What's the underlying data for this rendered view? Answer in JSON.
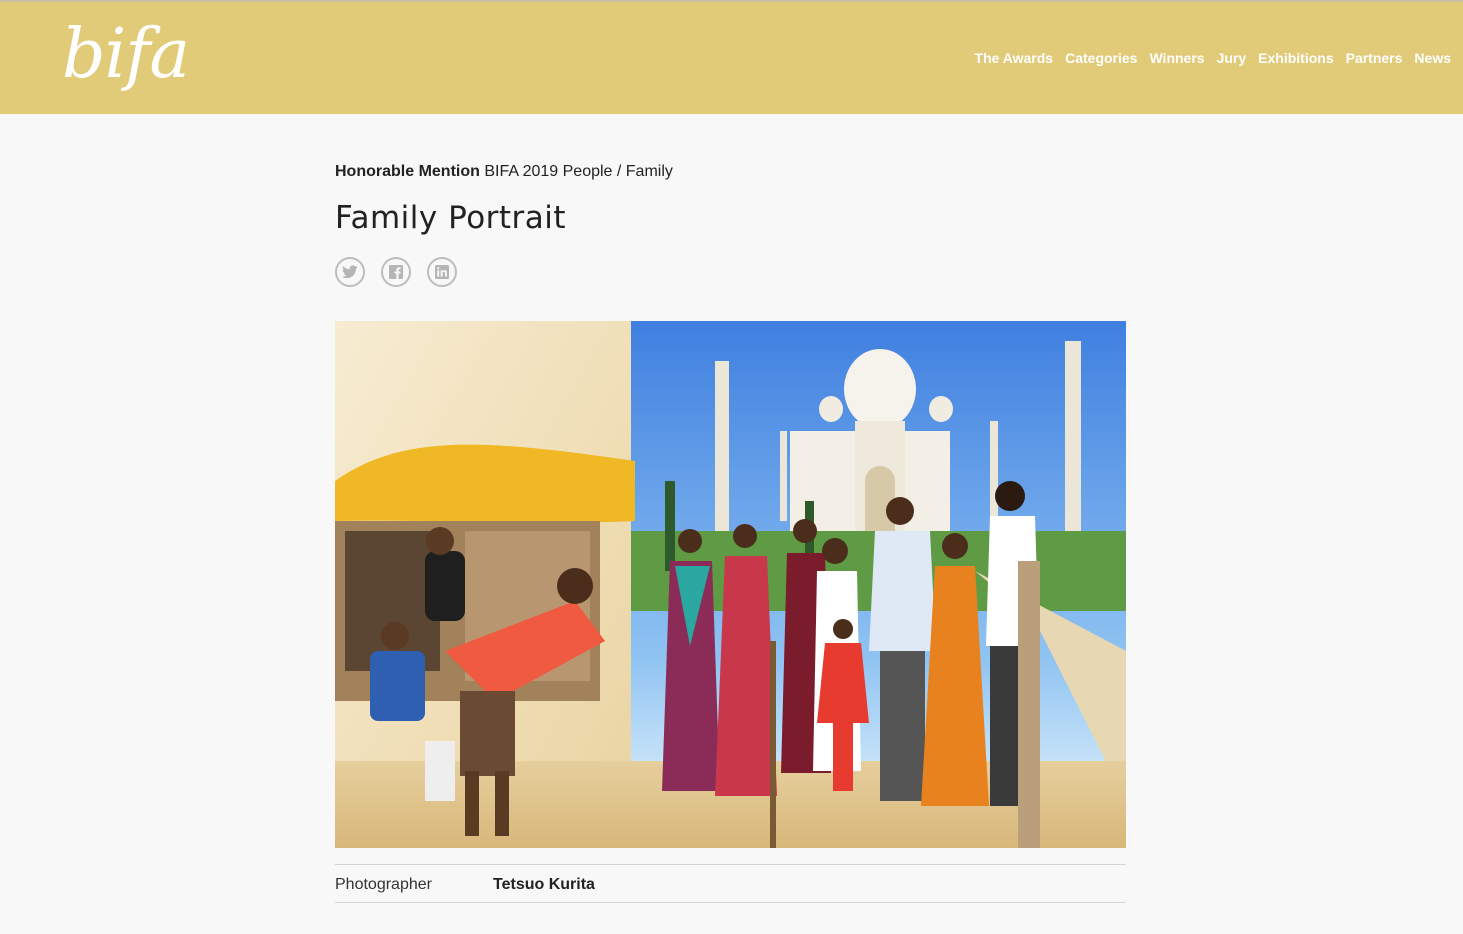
{
  "header": {
    "logo_text": "bifa",
    "nav": [
      "The Awards",
      "Categories",
      "Winners",
      "Jury",
      "Exhibitions",
      "Partners",
      "News"
    ]
  },
  "entry": {
    "award": "Honorable Mention",
    "competition": "BIFA 2019 People / Family",
    "title": "Family Portrait",
    "share_icons": [
      "twitter-icon",
      "facebook-icon",
      "linkedin-icon"
    ],
    "credit_label": "Photographer",
    "credit_value": "Tetsuo Kurita"
  },
  "colors": {
    "header_bg": "#e1cb78",
    "page_bg": "#f8f8f8",
    "icon_gray": "#bdbdbd"
  }
}
